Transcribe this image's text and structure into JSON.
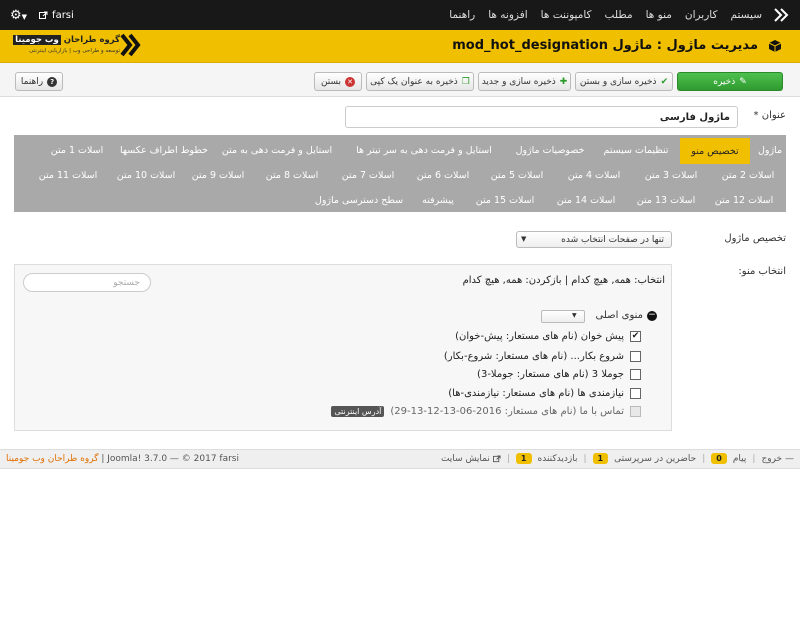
{
  "topbar": {
    "nav": [
      "سیستم",
      "کاربران",
      "منو ها",
      "مطلب",
      "کامپوننت ها",
      "افزونه ها",
      "راهنما"
    ],
    "site_label": "farsi"
  },
  "header": {
    "title": "مدیریت ماژول : ماژول mod_hot_designation",
    "brand_pre": "گروه طراحان",
    "brand_hl": "وب جومینا",
    "brand_tagline": "توسعه و طراحی وب | بازاریابی اینترنتی"
  },
  "toolbar": {
    "save": "ذخیره",
    "save_close": "ذخیره سازی و بستن",
    "save_new": "ذخیره سازی و جدید",
    "save_copy": "ذخیره به عنوان یک کپی",
    "close": "بستن",
    "help": "راهنما"
  },
  "form": {
    "title_label": "عنوان *",
    "title_value": "ماژول فارسی",
    "assignment_label": "تخصیص ماژول",
    "assignment_value": "تنها در صفحات انتخاب شده",
    "menu_select_label": "انتخاب منو:"
  },
  "tabs": {
    "row1": [
      "ماژول",
      "تخصیص منو",
      "تنظیمات سیستم",
      "خصوصیات ماژول",
      "استایل و فرمت دهی به سر تیتر ها",
      "استایل و فرمت دهی به متن",
      "خطوط اطراف عکسها",
      "اسلات 1 متن"
    ],
    "row2": [
      "اسلات 2 متن",
      "اسلات 3 متن",
      "اسلات 4 متن",
      "اسلات 5 متن",
      "اسلات 6 متن",
      "اسلات 7 متن",
      "اسلات 8 متن",
      "اسلات 9 متن",
      "اسلات 10 متن",
      "اسلات 11 متن"
    ],
    "row3": [
      "اسلات 12 متن",
      "اسلات 13 متن",
      "اسلات 14 متن",
      "اسلات 15 متن",
      "پیشرفته",
      "سطح دسترسی ماژول"
    ]
  },
  "panel": {
    "search_placeholder": "جستجو",
    "select_links": "انتخاب: همه, هیچ کدام | بازکردن: همه, هیچ کدام",
    "menu_title": "منوی اصلی",
    "items": [
      {
        "text": "پیش خوان (نام های مستعار: پیش-خوان)",
        "checked": "✔"
      },
      {
        "text": "شروع بکار... (نام های مستعار: شروع-بکار)",
        "checked": ""
      },
      {
        "text": "جوملا 3 (نام های مستعار: جوملا-3)",
        "checked": ""
      },
      {
        "text": "نیازمندی ها (نام های مستعار: نیازمندی-ها)",
        "checked": ""
      },
      {
        "text": "تماس با ما (نام های مستعار: 2016-06-13-12-13-29)",
        "checked": "",
        "badge": "آدرس اینترنتی"
      }
    ]
  },
  "footer": {
    "copyright": "Joomla! 3.7.0 — © 2017 farsi",
    "group": "گروه طراحان وب جومینا",
    "view_site": "نمایش سایت",
    "visitors_count": "1",
    "visitors_label": "بازدیدکننده",
    "admins_count": "1",
    "admins_label": "حاضرین در سرپرستی",
    "messages_count": "0",
    "messages_label": "پیام",
    "logout": "خروج"
  },
  "colors": {
    "accent": "#f0c000",
    "topbar": "#181818",
    "tabs_bg": "#a9a9a9",
    "save_green": "#3aaa3a"
  }
}
